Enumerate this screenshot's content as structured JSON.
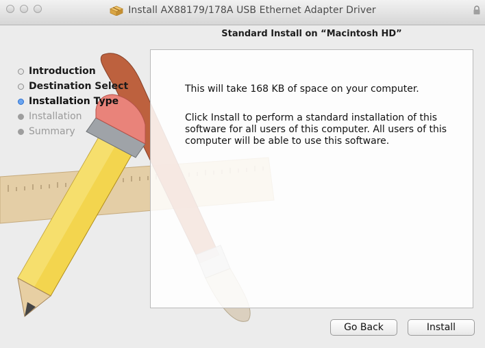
{
  "window": {
    "title": "Install AX88179/178A USB Ethernet Adapter Driver"
  },
  "header": {
    "subtitle": "Standard Install on “Macintosh HD”"
  },
  "steps": [
    {
      "label": "Introduction",
      "state": "done"
    },
    {
      "label": "Destination Select",
      "state": "done"
    },
    {
      "label": "Installation Type",
      "state": "current"
    },
    {
      "label": "Installation",
      "state": "pending"
    },
    {
      "label": "Summary",
      "state": "pending"
    }
  ],
  "content": {
    "space_text": "This will take 168 KB of space on your computer.",
    "description": "Click Install to perform a standard installation of this software for all users of this computer. All users of this computer will be able to use this software."
  },
  "buttons": {
    "go_back": "Go Back",
    "install": "Install"
  },
  "icons": {
    "title": "installer-package-icon",
    "lock": "lock-icon",
    "background": "pencil-ruler-brush-artwork"
  }
}
